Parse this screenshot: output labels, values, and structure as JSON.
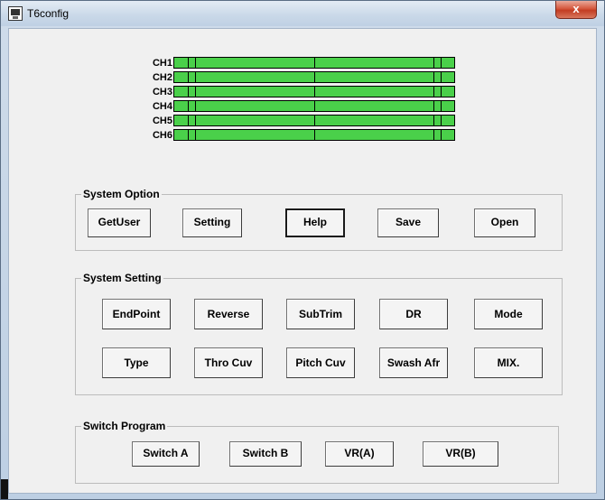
{
  "window": {
    "title": "T6config",
    "close_glyph": "x"
  },
  "channels": [
    {
      "label": "CH1"
    },
    {
      "label": "CH2"
    },
    {
      "label": "CH3"
    },
    {
      "label": "CH4"
    },
    {
      "label": "CH5"
    },
    {
      "label": "CH6"
    }
  ],
  "channel_bar_color": "#4ad04a",
  "system_option": {
    "title": "System Option",
    "buttons": [
      "GetUser",
      "Setting",
      "Help",
      "Save",
      "Open"
    ]
  },
  "system_setting": {
    "title": "System Setting",
    "row1": [
      "EndPoint",
      "Reverse",
      "SubTrim",
      "DR",
      "Mode"
    ],
    "row2": [
      "Type",
      "Thro Cuv",
      "Pitch Cuv",
      "Swash Afr",
      "MIX."
    ]
  },
  "switch_program": {
    "title": "Switch Program",
    "buttons": [
      "Switch A",
      "Switch B",
      "VR(A)",
      "VR(B)"
    ]
  }
}
